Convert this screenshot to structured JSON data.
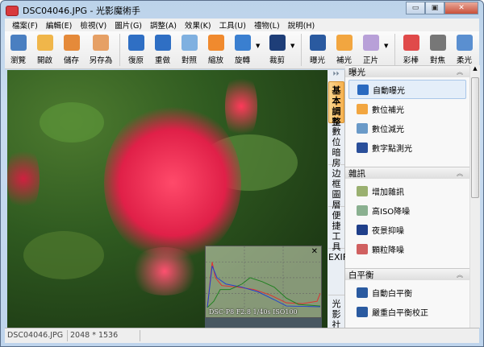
{
  "window": {
    "title": "DSC04046.JPG - 光影魔術手",
    "minimize": "▭",
    "maximize": "▣",
    "close": "✕"
  },
  "menu": [
    "檔案(F)",
    "編輯(E)",
    "檢視(V)",
    "圖片(G)",
    "調整(A)",
    "效果(K)",
    "工具(U)",
    "禮物(L)",
    "說明(H)"
  ],
  "toolbar": [
    {
      "label": "瀏覽",
      "icon": "eye-icon",
      "color": "#4a7fc1"
    },
    {
      "label": "開啟",
      "icon": "folder-open-icon",
      "color": "#f0b64a"
    },
    {
      "label": "儲存",
      "icon": "save-icon",
      "color": "#e58a3a"
    },
    {
      "label": "另存為",
      "icon": "save-as-icon",
      "color": "#e6a065"
    },
    {
      "label": "復原",
      "icon": "undo-icon",
      "color": "#2f6fc4"
    },
    {
      "label": "重做",
      "icon": "redo-icon",
      "color": "#2f6fc4"
    },
    {
      "label": "對照",
      "icon": "compare-icon",
      "color": "#7fb0e0"
    },
    {
      "label": "縮放",
      "icon": "resize-icon",
      "color": "#f08a2e"
    },
    {
      "label": "旋轉",
      "icon": "rotate-icon",
      "color": "#3a7fd0"
    },
    {
      "label": "裁剪",
      "icon": "crop-icon",
      "color": "#1e3e78"
    },
    {
      "label": "曝光",
      "icon": "exposure-icon",
      "color": "#2a5aa0"
    },
    {
      "label": "補光",
      "icon": "fill-light-icon",
      "color": "#f2a640"
    },
    {
      "label": "正片",
      "icon": "positive-film-icon",
      "color": "#b8a0d8"
    },
    {
      "label": "彩棒",
      "icon": "color-wand-icon",
      "color": "#e04a4a"
    },
    {
      "label": "對焦",
      "icon": "focus-icon",
      "color": "#777777"
    },
    {
      "label": "柔光",
      "icon": "soft-light-icon",
      "color": "#5a8fd0"
    }
  ],
  "histogram": {
    "close": "✕",
    "caption": "DSC-P8 F2.8 1/40s ISO100"
  },
  "vertical_tabs": [
    "基本調整",
    "數位暗房",
    "边框圖層",
    "便捷工具",
    "EXIF",
    "光影社區"
  ],
  "panel": {
    "sections": [
      {
        "title": "曝光",
        "items": [
          {
            "label": "自動曝光",
            "color": "#2a6ac0"
          },
          {
            "label": "數位補光",
            "color": "#f2a640"
          },
          {
            "label": "數位減光",
            "color": "#6a9ac8"
          },
          {
            "label": "數字點測光",
            "color": "#2a4f9a"
          }
        ]
      },
      {
        "title": "雜訊",
        "items": [
          {
            "label": "增加雜訊",
            "color": "#9ab070"
          },
          {
            "label": "高ISO降噪",
            "color": "#8ab090"
          },
          {
            "label": "夜景抑噪",
            "color": "#1f3f8a"
          },
          {
            "label": "顆粒降噪",
            "color": "#d06060"
          }
        ]
      },
      {
        "title": "白平衡",
        "items": [
          {
            "label": "自動白平衡",
            "color": "#2a5aa0"
          },
          {
            "label": "嚴重白平衡校正",
            "color": "#2a5aa0"
          }
        ]
      }
    ]
  },
  "status": {
    "filename": "DSC04046.JPG",
    "dimensions": "2048 * 1536"
  }
}
